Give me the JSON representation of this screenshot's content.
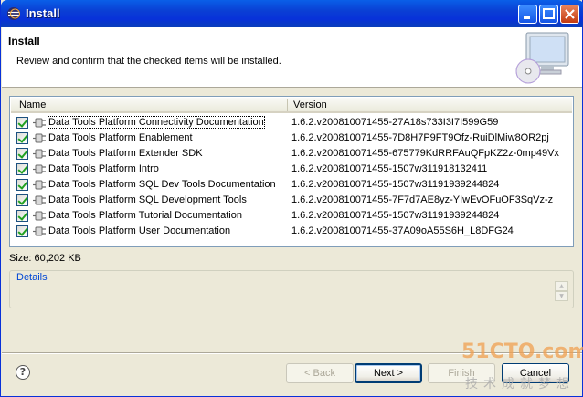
{
  "window": {
    "title": "Install"
  },
  "header": {
    "title": "Install",
    "description": "Review and confirm that the checked items will be installed."
  },
  "table": {
    "columns": [
      "Name",
      "Version"
    ],
    "rows": [
      {
        "checked": true,
        "name": "Data Tools Platform Connectivity Documentation",
        "version": "1.6.2.v200810071455-27A18s733I3I7I599G59"
      },
      {
        "checked": true,
        "name": "Data Tools Platform Enablement",
        "version": "1.6.2.v200810071455-7D8H7P9FT9Ofz-RuiDlMiw8OR2pj"
      },
      {
        "checked": true,
        "name": "Data Tools Platform Extender SDK",
        "version": "1.6.2.v200810071455-675779KdRRFAuQFpKZ2z-0mp49Vx"
      },
      {
        "checked": true,
        "name": "Data Tools Platform Intro",
        "version": "1.6.2.v200810071455-1507w311918132411"
      },
      {
        "checked": true,
        "name": "Data Tools Platform SQL Dev Tools Documentation",
        "version": "1.6.2.v200810071455-1507w31191939244824"
      },
      {
        "checked": true,
        "name": "Data Tools Platform SQL Development Tools",
        "version": "1.6.2.v200810071455-7F7d7AE8yz-YIwEvOFuOF3SqVz-z"
      },
      {
        "checked": true,
        "name": "Data Tools Platform Tutorial Documentation",
        "version": "1.6.2.v200810071455-1507w31191939244824"
      },
      {
        "checked": true,
        "name": "Data Tools Platform User Documentation",
        "version": "1.6.2.v200810071455-37A09oA55S6H_L8DFG24"
      }
    ]
  },
  "size_label": "Size: 60,202 KB",
  "details": {
    "label": "Details"
  },
  "buttons": {
    "back": "< Back",
    "next": "Next >",
    "finish": "Finish",
    "cancel": "Cancel"
  },
  "watermark": {
    "main": "51CTO.com",
    "sub": "技术成就梦想"
  }
}
